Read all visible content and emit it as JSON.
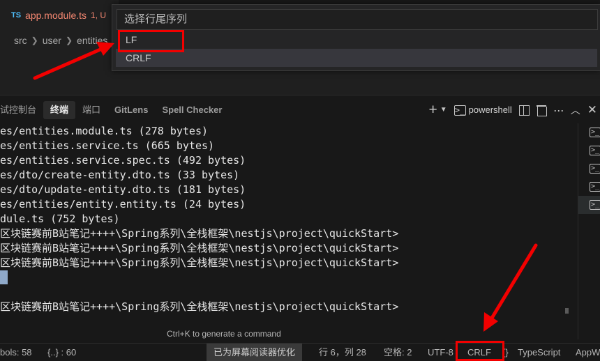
{
  "editor": {
    "tab": {
      "lang_badge": "TS",
      "filename": "app.module.ts",
      "problems": "1, U"
    },
    "breadcrumb": [
      "src",
      "user",
      "entities"
    ]
  },
  "quick_pick": {
    "placeholder": "选择行尾序列",
    "items": [
      "LF",
      "CRLF"
    ],
    "selected": "CRLF"
  },
  "panel": {
    "tabs": [
      "试控制台",
      "终端",
      "端口",
      "GitLens",
      "Spell Checker"
    ],
    "active_tab": "终端",
    "terminal_name": "powershell",
    "terminal_lines": [
      "es/entities.module.ts (278 bytes)",
      "es/entities.service.ts (665 bytes)",
      "es/entities.service.spec.ts (492 bytes)",
      "es/dto/create-entity.dto.ts (33 bytes)",
      "es/dto/update-entity.dto.ts (181 bytes)",
      "es/entities/entity.entity.ts (24 bytes)",
      "dule.ts (752 bytes)",
      "区块链赛前B站笔记++++\\Spring系列\\全栈框架\\nestjs\\project\\quickStart>",
      "区块链赛前B站笔记++++\\Spring系列\\全栈框架\\nestjs\\project\\quickStart>",
      "区块链赛前B站笔记++++\\Spring系列\\全栈框架\\nestjs\\project\\quickStart>",
      "",
      "",
      "区块链赛前B站笔记++++\\Spring系列\\全栈框架\\nestjs\\project\\quickStart>"
    ],
    "hint": "Ctrl+K to generate a command",
    "terminal_list_count": 5,
    "terminal_list_selected": 4
  },
  "statusbar": {
    "symbols": "bols: 58",
    "braces": "{..} : 60",
    "screen_reader": "已为屏幕阅读器优化",
    "position": "行 6，列 28",
    "spaces": "空格: 2",
    "encoding": "UTF-8",
    "eol": "CRLF",
    "language": "TypeScript",
    "app": "AppW"
  },
  "colors": {
    "annotation_red": "#f20000",
    "error_text": "#f48771",
    "ts_blue": "#4fc1ff"
  }
}
